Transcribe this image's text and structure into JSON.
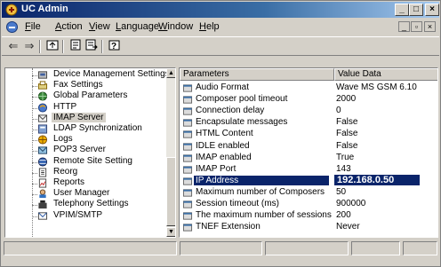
{
  "window": {
    "title": "UC Admin"
  },
  "menu": {
    "items": [
      {
        "label": "File"
      },
      {
        "label": "Action"
      },
      {
        "label": "View"
      },
      {
        "label": "Language"
      },
      {
        "label": "Window"
      },
      {
        "label": "Help"
      }
    ]
  },
  "toolbar": {
    "buttons": [
      "back-arrow-icon",
      "forward-arrow-icon",
      "up-folder-icon",
      "properties-icon",
      "export-list-icon",
      "help-icon"
    ]
  },
  "tree": {
    "items": [
      {
        "label": "Device Management Settings",
        "icon": "device-settings-icon"
      },
      {
        "label": "Fax Settings",
        "icon": "fax-icon"
      },
      {
        "label": "Global Parameters",
        "icon": "globe-icon"
      },
      {
        "label": "HTTP",
        "icon": "http-icon"
      },
      {
        "label": "IMAP Server",
        "icon": "imap-server-icon",
        "selected": true
      },
      {
        "label": "LDAP Synchronization",
        "icon": "ldap-icon"
      },
      {
        "label": "Logs",
        "icon": "logs-icon"
      },
      {
        "label": "POP3 Server",
        "icon": "pop3-icon"
      },
      {
        "label": "Remote Site Setting",
        "icon": "remote-site-icon"
      },
      {
        "label": "Reorg",
        "icon": "reorg-icon"
      },
      {
        "label": "Reports",
        "icon": "reports-icon"
      },
      {
        "label": "User Manager",
        "icon": "user-manager-icon"
      },
      {
        "label": "Telephony Settings",
        "icon": "telephony-icon"
      },
      {
        "label": "VPIM/SMTP",
        "icon": "vpim-icon"
      }
    ]
  },
  "list": {
    "columns": {
      "name": "Parameters",
      "value": "Value Data"
    },
    "rows": [
      {
        "name": "Audio Format",
        "value": "Wave MS GSM 6.10"
      },
      {
        "name": "Composer pool timeout",
        "value": "2000"
      },
      {
        "name": "Connection delay",
        "value": "0"
      },
      {
        "name": "Encapsulate messages",
        "value": "False"
      },
      {
        "name": "HTML Content",
        "value": "False"
      },
      {
        "name": "IDLE enabled",
        "value": "False"
      },
      {
        "name": "IMAP enabled",
        "value": "True"
      },
      {
        "name": "IMAP Port",
        "value": "143"
      },
      {
        "name": "IP Address",
        "value": "192.168.0.50",
        "selected": true
      },
      {
        "name": "Maximum number of Composers",
        "value": "50"
      },
      {
        "name": "Session timeout (ms)",
        "value": "900000"
      },
      {
        "name": "The maximum number of sessions",
        "value": "200"
      },
      {
        "name": "TNEF Extension",
        "value": "Never"
      }
    ]
  },
  "colors": {
    "titlebar": "#0a246a",
    "selection": "#0a246a",
    "face": "#d4d0c8"
  }
}
